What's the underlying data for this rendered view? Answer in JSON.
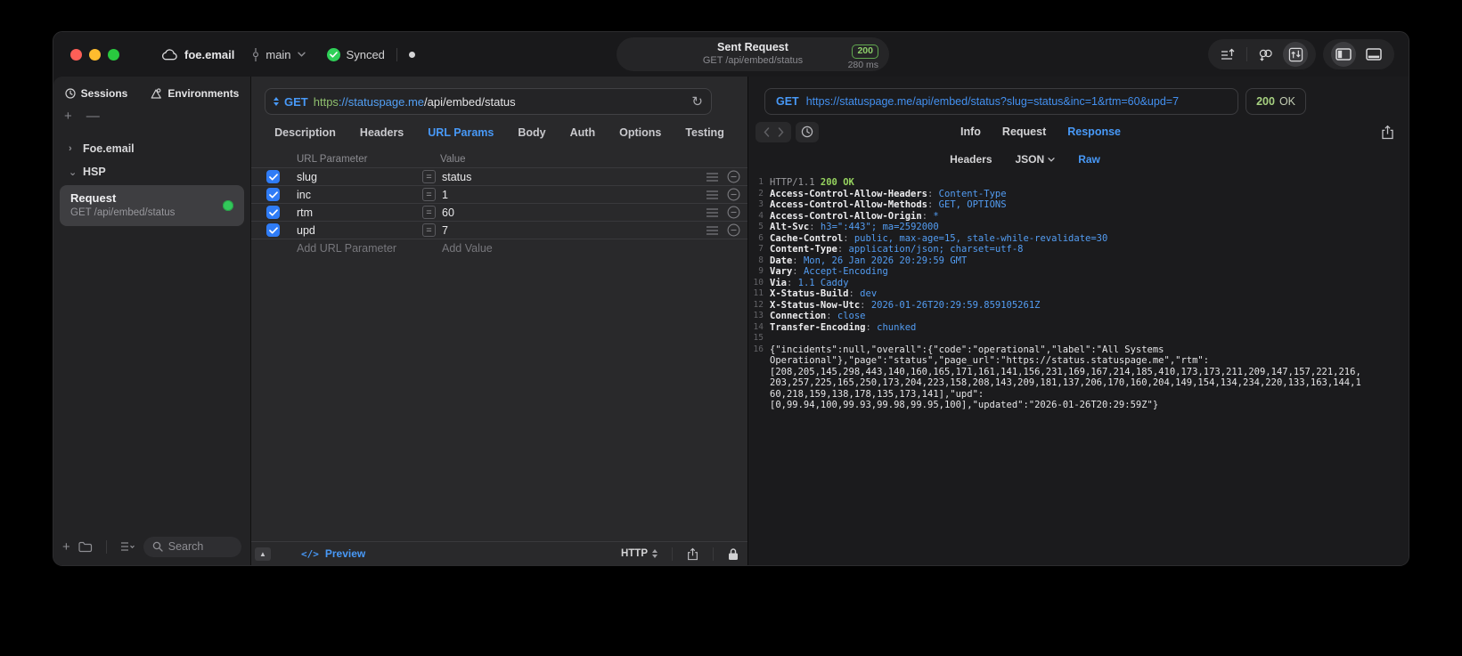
{
  "colors": {
    "accent_blue": "#4899f7",
    "success_green": "#2fd058",
    "code_green": "#96d35f",
    "status_dot_green": "#32c85a"
  },
  "window": {
    "account": "foe.email",
    "branch": "main",
    "sync_status": "Synced",
    "title": "Sent Request",
    "subtitle": "GET /api/embed/status",
    "status_code": "200",
    "duration": "280 ms"
  },
  "sidebar": {
    "tabs": [
      {
        "label": "Sessions",
        "icon": "clock-icon"
      },
      {
        "label": "Environments",
        "icon": "environments-icon"
      }
    ],
    "tree": [
      {
        "label": "Foe.email",
        "expanded": false
      },
      {
        "label": "HSP",
        "expanded": true
      }
    ],
    "request_item": {
      "title": "Request",
      "subtitle": "GET /api/embed/status"
    },
    "search_placeholder": "Search"
  },
  "request_panel": {
    "method": "GET",
    "url_scheme": "https",
    "url_host": "://statuspage.me",
    "url_path": "/api/embed/status",
    "tabs": [
      "Description",
      "Headers",
      "URL Params",
      "Body",
      "Auth",
      "Options",
      "Testing"
    ],
    "active_tab": "URL Params",
    "param_table": {
      "columns": [
        "URL Parameter",
        "Value"
      ],
      "rows": [
        {
          "name": "slug",
          "value": "status",
          "enabled": true
        },
        {
          "name": "inc",
          "value": "1",
          "enabled": true
        },
        {
          "name": "rtm",
          "value": "60",
          "enabled": true
        },
        {
          "name": "upd",
          "value": "7",
          "enabled": true
        }
      ],
      "add_name_placeholder": "Add URL Parameter",
      "add_value_placeholder": "Add Value"
    },
    "footer": {
      "preview_label": "Preview",
      "protocol": "HTTP"
    }
  },
  "response_panel": {
    "method": "GET",
    "url": "https://statuspage.me/api/embed/status?slug=status&inc=1&rtm=60&upd=7",
    "status_code": "200",
    "status_text": "OK",
    "tabs": [
      "Info",
      "Request",
      "Response"
    ],
    "active_tab": "Response",
    "subtabs": [
      "Headers",
      "JSON",
      "Raw"
    ],
    "active_subtab": "Raw",
    "status_line": {
      "protocol": "HTTP/1.1",
      "status": "200 OK"
    },
    "headers": [
      {
        "name": "Access-Control-Allow-Headers",
        "value": "Content-Type"
      },
      {
        "name": "Access-Control-Allow-Methods",
        "value": "GET, OPTIONS"
      },
      {
        "name": "Access-Control-Allow-Origin",
        "value": "*"
      },
      {
        "name": "Alt-Svc",
        "value": "h3=\":443\"; ma=2592000"
      },
      {
        "name": "Cache-Control",
        "value": "public, max-age=15, stale-while-revalidate=30"
      },
      {
        "name": "Content-Type",
        "value": "application/json; charset=utf-8"
      },
      {
        "name": "Date",
        "value": "Mon, 26 Jan 2026 20:29:59 GMT"
      },
      {
        "name": "Vary",
        "value": "Accept-Encoding"
      },
      {
        "name": "Via",
        "value": "1.1 Caddy"
      },
      {
        "name": "X-Status-Build",
        "value": "dev"
      },
      {
        "name": "X-Status-Now-Utc",
        "value": "2026-01-26T20:29:59.859105261Z"
      },
      {
        "name": "Connection",
        "value": "close"
      },
      {
        "name": "Transfer-Encoding",
        "value": "chunked"
      }
    ],
    "body_lines": [
      "{\"incidents\":null,\"overall\":{\"code\":\"operational\",\"label\":\"All Systems",
      "Operational\"},\"page\":\"status\",\"page_url\":\"https://status.statuspage.me\",\"rtm\":",
      "[208,205,145,298,443,140,160,165,171,161,141,156,231,169,167,214,185,410,173,173,211,209,147,157,221,216,",
      "203,257,225,165,250,173,204,223,158,208,143,209,181,137,206,170,160,204,149,154,134,234,220,133,163,144,1",
      "60,218,159,138,178,135,173,141],\"upd\":",
      "[0,99.94,100,99.93,99.98,99.95,100],\"updated\":\"2026-01-26T20:29:59Z\"}"
    ]
  }
}
